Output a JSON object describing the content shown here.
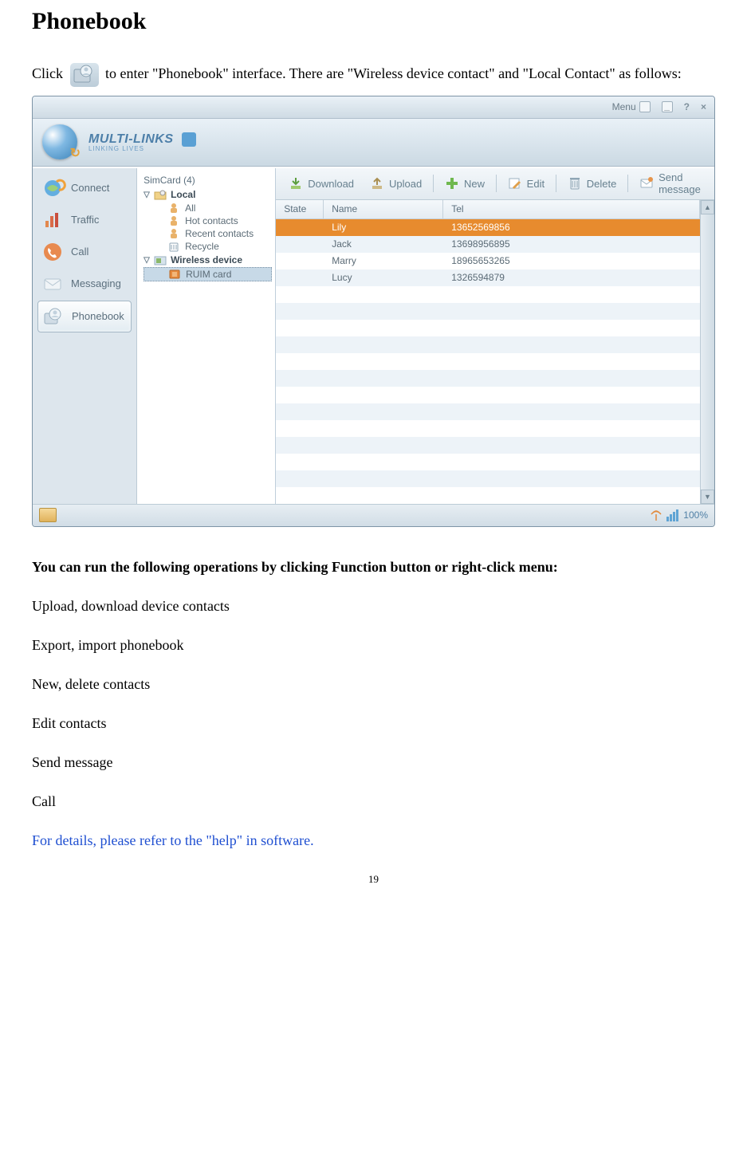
{
  "doc": {
    "title": "Phonebook",
    "intro_before": "Click ",
    "intro_after": " to enter \"Phonebook\" interface. There are \"Wireless device contact\" and \"Local Contact\" as follows:",
    "operations_heading": "You can run the following operations by clicking Function button or right-click menu:",
    "operations": [
      "Upload, download device contacts",
      "Export, import phonebook",
      "New, delete contacts",
      "Edit contacts",
      "Send message",
      "Call"
    ],
    "details_link": "For details, please refer to the \"help\" in software.",
    "page_number": "19"
  },
  "app": {
    "titlebar": {
      "menu": "Menu"
    },
    "brand": {
      "name": "MULTI-LINKS",
      "sub": "LINKING LIVES"
    },
    "sidebar": [
      {
        "label": "Connect"
      },
      {
        "label": "Traffic"
      },
      {
        "label": "Call"
      },
      {
        "label": "Messaging"
      },
      {
        "label": "Phonebook"
      }
    ],
    "tree": {
      "root": "SimCard (4)",
      "local": "Local",
      "local_children": [
        "All",
        "Hot contacts",
        "Recent contacts",
        "Recycle"
      ],
      "wireless": "Wireless device",
      "wireless_children": [
        "RUIM card"
      ]
    },
    "toolbar": {
      "download": "Download",
      "upload": "Upload",
      "new": "New",
      "edit": "Edit",
      "delete": "Delete",
      "send": "Send message"
    },
    "table": {
      "headers": {
        "state": "State",
        "name": "Name",
        "tel": "Tel"
      },
      "rows": [
        {
          "name": "Lily",
          "tel": "13652569856",
          "selected": true
        },
        {
          "name": "Jack",
          "tel": "13698956895",
          "selected": false
        },
        {
          "name": "Marry",
          "tel": "18965653265",
          "selected": false
        },
        {
          "name": "Lucy",
          "tel": "1326594879",
          "selected": false
        }
      ]
    },
    "status": {
      "signal": "100%"
    }
  }
}
